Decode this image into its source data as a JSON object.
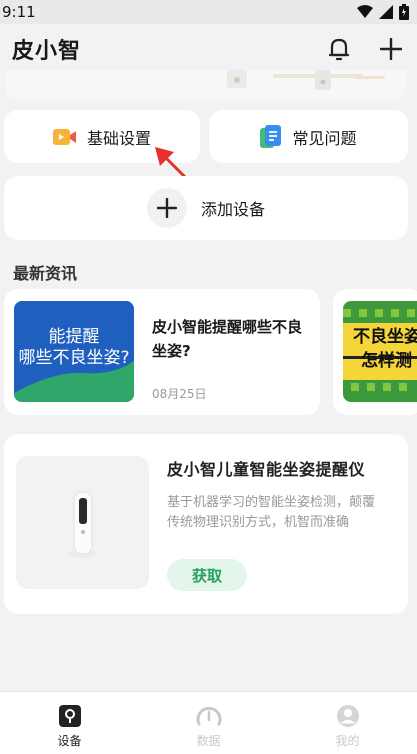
{
  "status_bar": {
    "time": "9:11"
  },
  "header": {
    "title": "皮小智"
  },
  "quick_actions": [
    {
      "label": "基础设置",
      "icon": "video-icon"
    },
    {
      "label": "常见问题",
      "icon": "document-icon"
    }
  ],
  "add_device": {
    "label": "添加设备"
  },
  "news": {
    "section_title": "最新资讯",
    "items": [
      {
        "thumb_text_1": "能提醒",
        "thumb_text_2": "哪些不良坐姿?",
        "title": "皮小智能提醒哪些不良坐姿?",
        "date": "08月25日"
      },
      {
        "thumb_text_1": "不良坐姿",
        "thumb_text_2": "怎样测"
      }
    ]
  },
  "product": {
    "name": "皮小智儿童智能坐姿提醒仪",
    "description": "基于机器学习的智能坐姿检测，颠覆传统物理识别方式，机智而准确",
    "button_label": "获取"
  },
  "bottom_nav": [
    {
      "label": "设备",
      "icon": "device-icon",
      "active": true
    },
    {
      "label": "数据",
      "icon": "gauge-icon",
      "active": false
    },
    {
      "label": "我的",
      "icon": "user-icon",
      "active": false
    }
  ],
  "colors": {
    "accent_green": "#27a15b",
    "thumb_blue": "#1f5fbf",
    "thumb_green": "#2fa66a"
  }
}
